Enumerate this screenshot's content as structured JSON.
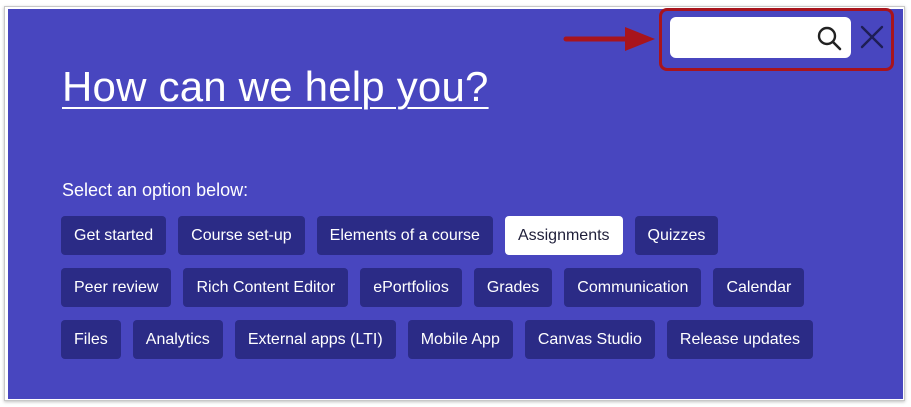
{
  "help": {
    "title": "How can we help you?",
    "prompt": "Select an option below:",
    "search": {
      "value": "",
      "placeholder": ""
    },
    "active_option": "Assignments",
    "options_rows": [
      [
        {
          "label": "Get started"
        },
        {
          "label": "Course set-up"
        },
        {
          "label": "Elements of a course"
        },
        {
          "label": "Assignments"
        },
        {
          "label": "Quizzes"
        }
      ],
      [
        {
          "label": "Peer review"
        },
        {
          "label": "Rich Content Editor"
        },
        {
          "label": "ePortfolios"
        },
        {
          "label": "Grades"
        },
        {
          "label": "Communication"
        },
        {
          "label": "Calendar"
        }
      ],
      [
        {
          "label": "Files"
        },
        {
          "label": "Analytics"
        },
        {
          "label": "External apps (LTI)"
        },
        {
          "label": "Mobile App"
        },
        {
          "label": "Canvas Studio"
        },
        {
          "label": "Release updates"
        }
      ]
    ]
  },
  "icons": {
    "search": "search-icon",
    "close": "close-icon",
    "annotation_arrow": "arrow-right-icon"
  },
  "colors": {
    "panel_bg": "#4846bf",
    "chip_bg": "#2b2b86",
    "chip_active_bg": "#ffffff",
    "annotation": "#a8141c"
  }
}
